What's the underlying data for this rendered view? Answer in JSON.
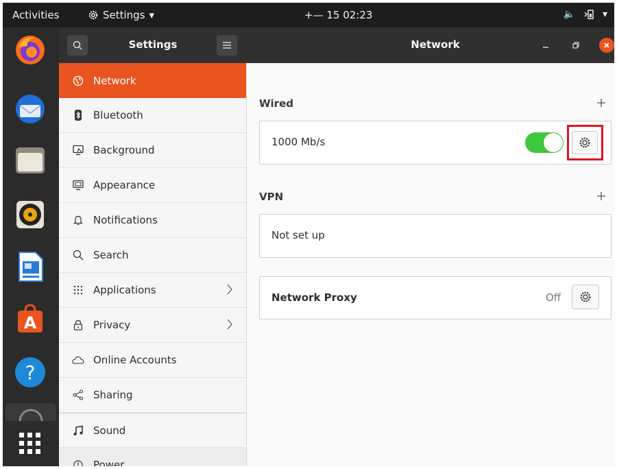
{
  "topbar": {
    "activities": "Activities",
    "app_menu": "Settings",
    "clock": "+— 15  02:23"
  },
  "dock": {
    "apps": [
      "firefox-icon",
      "thunderbird-icon",
      "files-icon",
      "rhythmbox-icon",
      "writer-icon",
      "software-icon",
      "help-icon",
      "app-grid-icon"
    ]
  },
  "sidebar": {
    "title": "Settings",
    "items": [
      {
        "label": "Network",
        "icon": "network-icon"
      },
      {
        "label": "Bluetooth",
        "icon": "bluetooth-icon"
      },
      {
        "label": "Background",
        "icon": "background-icon"
      },
      {
        "label": "Appearance",
        "icon": "appearance-icon"
      },
      {
        "label": "Notifications",
        "icon": "bell-icon"
      },
      {
        "label": "Search",
        "icon": "search-icon"
      },
      {
        "label": "Applications",
        "icon": "grid-icon"
      },
      {
        "label": "Privacy",
        "icon": "lock-icon"
      },
      {
        "label": "Online Accounts",
        "icon": "cloud-icon"
      },
      {
        "label": "Sharing",
        "icon": "share-icon"
      },
      {
        "label": "Sound",
        "icon": "music-icon"
      },
      {
        "label": "Power",
        "icon": "power-icon"
      }
    ]
  },
  "main": {
    "title": "Network",
    "wired": {
      "heading": "Wired",
      "speed": "1000 Mb/s",
      "enabled": true
    },
    "vpn": {
      "heading": "VPN",
      "status": "Not set up"
    },
    "proxy": {
      "label": "Network Proxy",
      "status": "Off"
    }
  },
  "colors": {
    "accent": "#e95420",
    "toggle_on": "#3ec83e",
    "highlight": "#e0141e"
  }
}
